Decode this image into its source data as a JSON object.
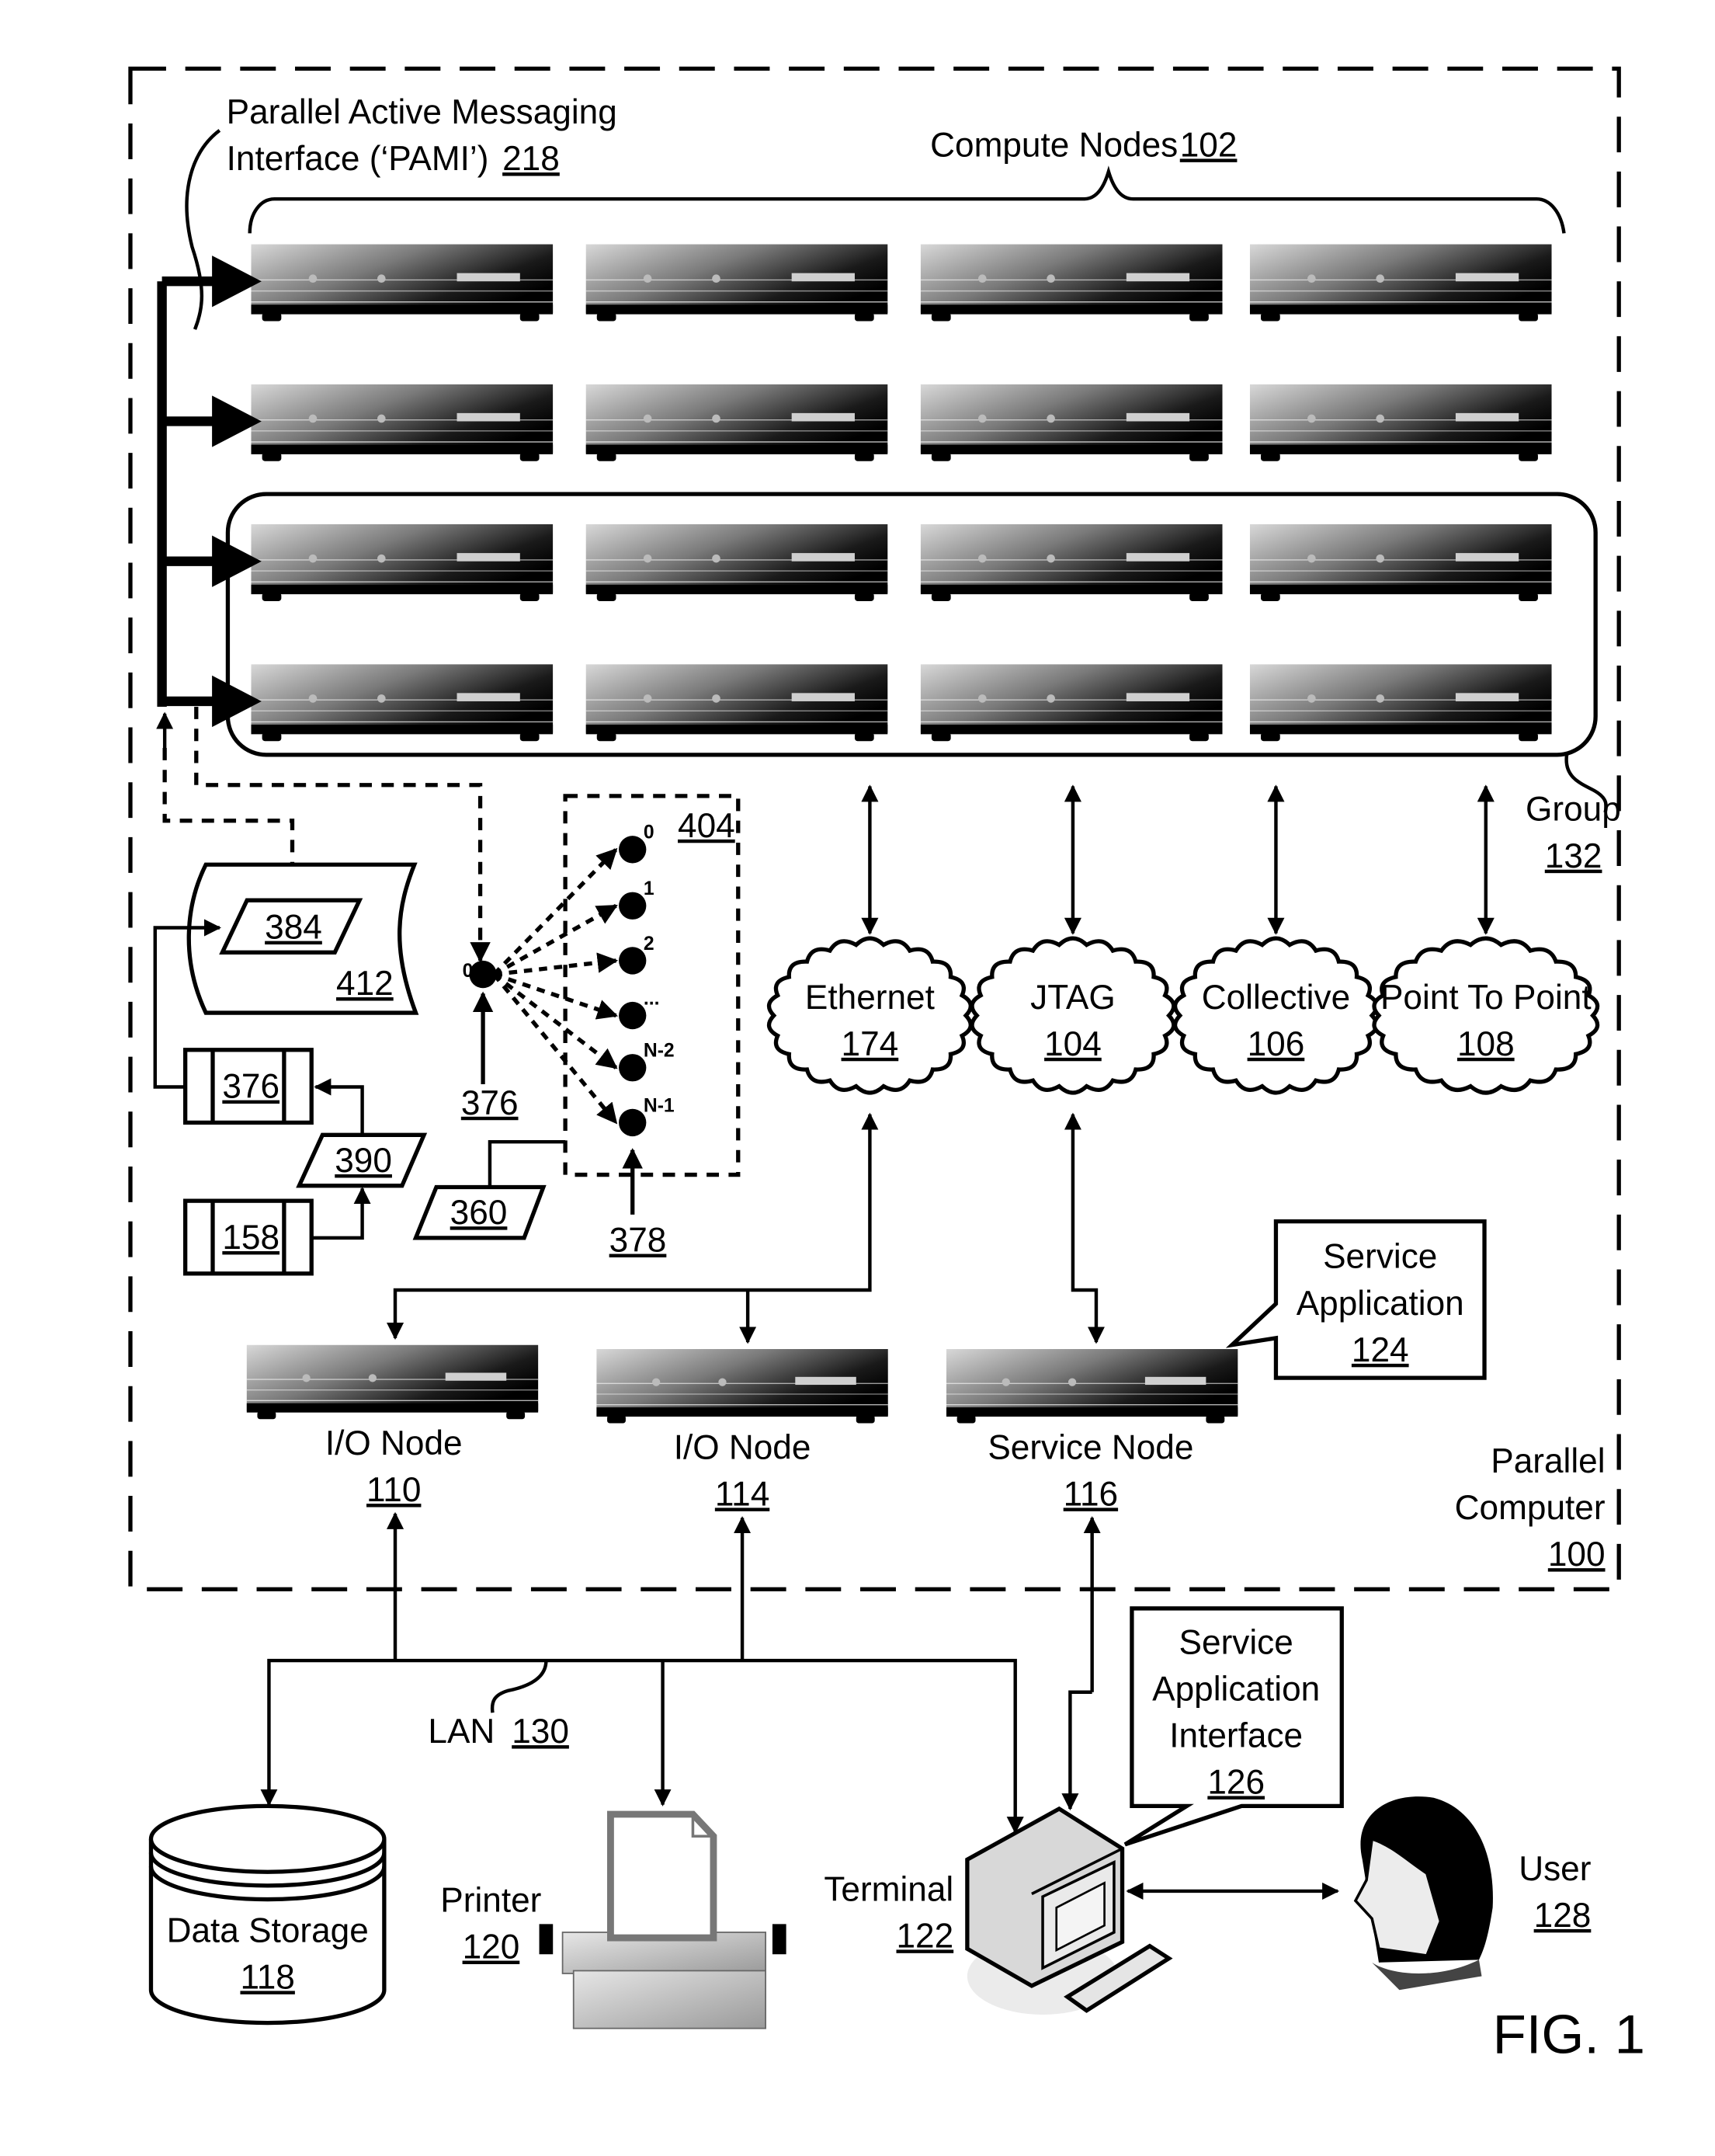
{
  "figure": {
    "caption": "FIG. 1",
    "parallel_computer": {
      "line1": "Parallel",
      "line2": "Computer",
      "ref": "100"
    },
    "pami": {
      "line1": "Parallel Active Messaging",
      "line2": "Interface (‘PAMI’)",
      "ref": "218"
    },
    "compute_nodes": {
      "label": "Compute Nodes",
      "ref": "102",
      "rows": 4,
      "cols": 4
    },
    "group": {
      "label": "Group",
      "ref": "132"
    },
    "networks": [
      {
        "label": "Ethernet",
        "ref": "174"
      },
      {
        "label": "JTAG",
        "ref": "104"
      },
      {
        "label": "Collective",
        "ref": "106"
      },
      {
        "label": "Point To Point",
        "ref": "108"
      }
    ],
    "io_nodes": [
      {
        "label": "I/O Node",
        "ref": "110"
      },
      {
        "label": "I/O Node",
        "ref": "114"
      }
    ],
    "service_node": {
      "label": "Service Node",
      "ref": "116"
    },
    "service_application": {
      "line1": "Service",
      "line2": "Application",
      "ref": "124"
    },
    "service_application_interface": {
      "line1": "Service",
      "line2": "Application",
      "line3": "Interface",
      "ref": "126"
    },
    "lan": {
      "label": "LAN",
      "ref": "130"
    },
    "data_storage": {
      "label": "Data Storage",
      "ref": "118"
    },
    "printer": {
      "label": "Printer",
      "ref": "120"
    },
    "terminal": {
      "label": "Terminal",
      "ref": "122"
    },
    "user": {
      "label": "User",
      "ref": "128"
    },
    "refs": {
      "r384": "384",
      "r412": "412",
      "r376a": "376",
      "r390": "390",
      "r158": "158",
      "r376b": "376",
      "r360": "360",
      "r378": "378",
      "r404": "404"
    },
    "tree": {
      "root_label": "0",
      "leaf_labels": [
        "0",
        "1",
        "2",
        "...",
        "N-2",
        "N-1"
      ]
    }
  }
}
